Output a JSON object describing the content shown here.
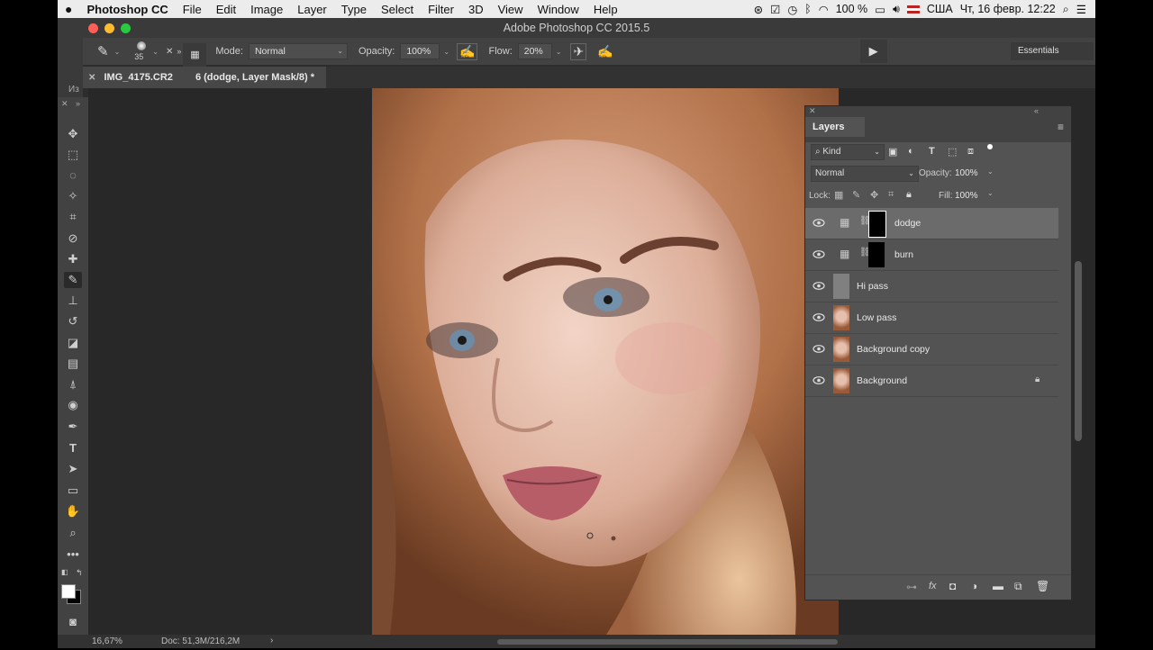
{
  "menubar": {
    "apple": "",
    "app_name": "Photoshop CC",
    "items": [
      "File",
      "Edit",
      "Image",
      "Layer",
      "Type",
      "Select",
      "Filter",
      "3D",
      "View",
      "Window",
      "Help"
    ],
    "status": {
      "battery": "100 %",
      "locale": "США",
      "datetime": "Чт, 16 февр.  12:22"
    }
  },
  "window": {
    "title": "Adobe Photoshop CC 2015.5"
  },
  "options_bar": {
    "brush_size": "35",
    "mode_label": "Mode:",
    "mode_value": "Normal",
    "opacity_label": "Opacity:",
    "opacity_value": "100%",
    "flow_label": "Flow:",
    "flow_value": "20%",
    "workspace": "Essentials"
  },
  "document_tab": {
    "title": "IMG_4175.CR2 @ 16.7% (dodge, Layer Mask/8) *",
    "visible_left": "IMG_4175.CR2",
    "visible_right": "6 (dodge, Layer Mask/8) *"
  },
  "side_label": "Из",
  "status_bar": {
    "zoom": "16,67%",
    "doc": "Doc: 51,3M/216,2M"
  },
  "layers_panel": {
    "tab": "Layers",
    "filter_kind": "Kind",
    "blend_mode": "Normal",
    "opacity_label": "Opacity:",
    "opacity_value": "100%",
    "lock_label": "Lock:",
    "fill_label": "Fill:",
    "fill_value": "100%",
    "layers": [
      {
        "name": "dodge",
        "type": "adjustment-mask",
        "selected": true,
        "locked": false
      },
      {
        "name": "burn",
        "type": "adjustment-mask",
        "selected": false,
        "locked": false
      },
      {
        "name": "Hi pass",
        "type": "gray",
        "selected": false,
        "locked": false
      },
      {
        "name": "Low pass",
        "type": "photo",
        "selected": false,
        "locked": false
      },
      {
        "name": "Background copy",
        "type": "photo",
        "selected": false,
        "locked": false
      },
      {
        "name": "Background",
        "type": "photo",
        "selected": false,
        "locked": true
      }
    ],
    "footer_icons": [
      "link-icon",
      "fx-icon",
      "mask-icon",
      "adjustment-icon",
      "folder-icon",
      "new-layer-icon",
      "trash-icon"
    ]
  },
  "colors": {
    "menubar": "#ececec",
    "panel": "#535353",
    "canvas": "#282828",
    "selected_layer": "#6b6b6b"
  }
}
